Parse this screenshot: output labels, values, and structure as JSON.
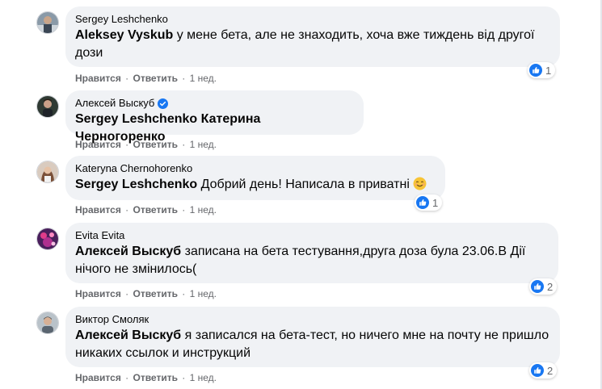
{
  "comments": [
    {
      "author": "Sergey Leshchenko",
      "mention": "Aleksey Vyskub",
      "text": " у мене бета, але не знаходить, хоча вже тиждень від другої дози",
      "like": "Нравится",
      "reply": "Ответить",
      "time": "1 нед.",
      "reactions": "1"
    },
    {
      "author": "Алексей Выскуб",
      "mention": "Sergey Leshchenko Катерина Черногоренко",
      "text": "",
      "like": "Нравится",
      "reply": "Ответить",
      "time": "1 нед.",
      "reactions": ""
    },
    {
      "author": "Kateryna Chernohorenko",
      "mention": "Sergey Leshchenko",
      "text": " Добрий день! Написала в приватні",
      "like": "Нравится",
      "reply": "Ответить",
      "time": "1 нед.",
      "reactions": "1"
    },
    {
      "author": "Evita Evita",
      "mention": "Алексей Выскуб",
      "text": " записана на бета тестування,друга доза була 23.06.В Дії нічого не змінилось(",
      "like": "Нравится",
      "reply": "Ответить",
      "time": "1 нед.",
      "reactions": "2"
    },
    {
      "author": "Виктор Смоляк",
      "mention": "Алексей Выскуб",
      "text": " я записался на бета-тест, но ничего мне на почту не пришло никаких ссылок и инструкций",
      "like": "Нравится",
      "reply": "Ответить",
      "time": "1 нед.",
      "reactions": "2"
    }
  ],
  "colors": {
    "bubble": "#f0f2f5",
    "secondary_text": "#65676b",
    "like_blue": "#1877f2"
  },
  "icons": {
    "verified": "verified-badge-icon",
    "like": "thumbs-up-icon",
    "emoji": "smiling-emoji-icon"
  }
}
